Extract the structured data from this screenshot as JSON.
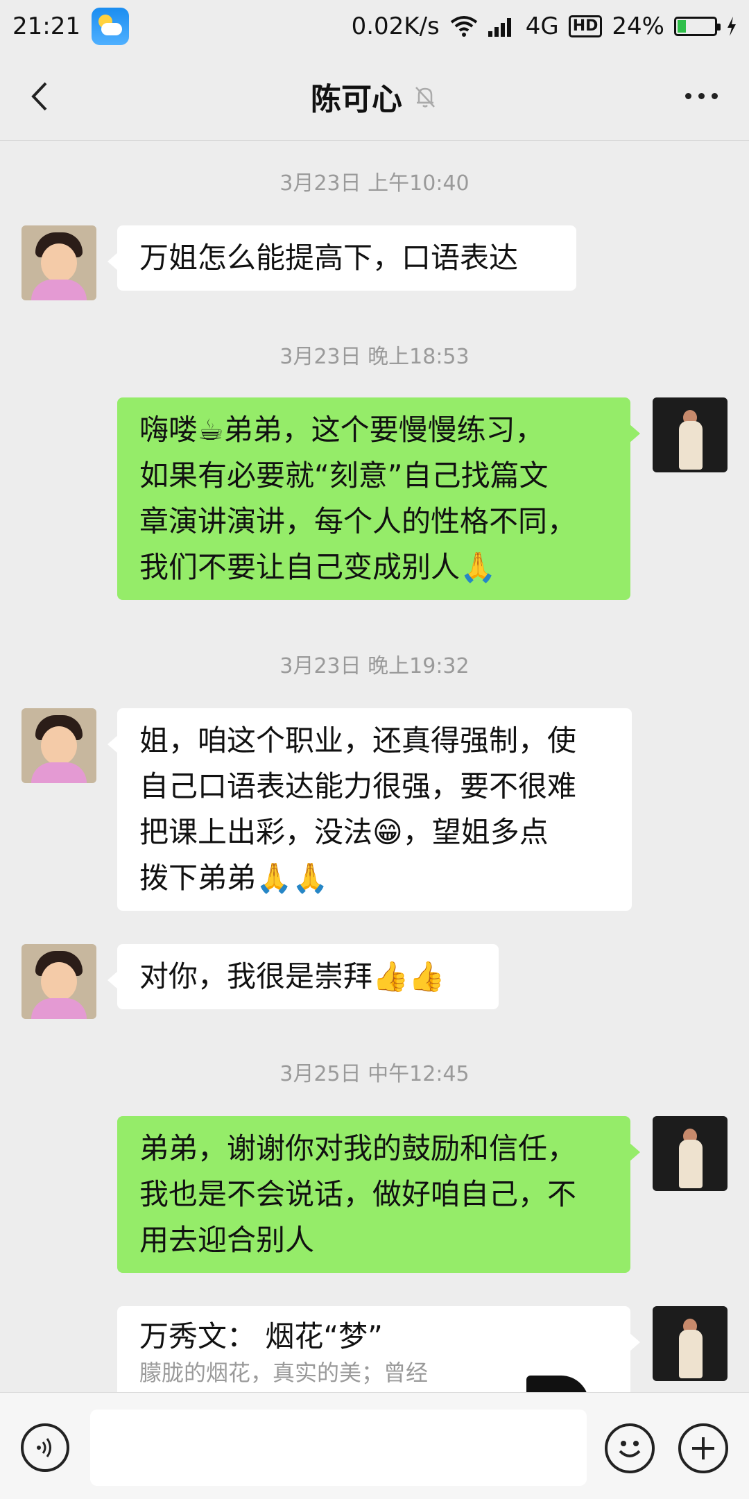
{
  "status_bar": {
    "time": "21:21",
    "net_speed": "0.02K/s",
    "network": "4G",
    "hd_label": "HD",
    "battery": "24%",
    "battery_level": 0.24
  },
  "header": {
    "title": "陈可心",
    "icons": [
      "back-arrow-icon",
      "mute-bell-icon",
      "more-options-icon"
    ]
  },
  "messages": [
    {
      "type": "timestamp",
      "text": "3月23日 上午10:40"
    },
    {
      "type": "incoming",
      "lines": [
        "万姐怎么能提高下，口语表达"
      ]
    },
    {
      "type": "timestamp",
      "text": "3月23日 晚上18:53"
    },
    {
      "type": "outgoing",
      "lines": [
        "嗨喽☕弟弟，这个要慢慢练习，",
        "如果有必要就“刻意”自己找篇文",
        "章演讲演讲，每个人的性格不同，",
        "我们不要让自己变成别人🙏"
      ]
    },
    {
      "type": "timestamp",
      "text": "3月23日 晚上19:32"
    },
    {
      "type": "incoming",
      "lines": [
        "姐，咱这个职业，还真得强制，使",
        "自己口语表达能力很强，要不很难",
        "把课上出彩，没法😁，望姐多点",
        "拨下弟弟🙏🙏"
      ]
    },
    {
      "type": "incoming",
      "lines": [
        "对你，我很是崇拜👍👍"
      ]
    },
    {
      "type": "timestamp",
      "text": "3月25日 中午12:45"
    },
    {
      "type": "outgoing",
      "lines": [
        "弟弟，谢谢你对我的鼓励和信任，",
        "我也是不会说话，做好咱自己，不",
        "用去迎合别人"
      ]
    },
    {
      "type": "card",
      "title": "万秀文：  烟花“梦”",
      "desc": "朦胧的烟花，真实的美；曾经"
    }
  ],
  "input_bar": {
    "placeholder": "",
    "icons": [
      "voice-icon",
      "emoji-icon",
      "plus-icon"
    ]
  }
}
